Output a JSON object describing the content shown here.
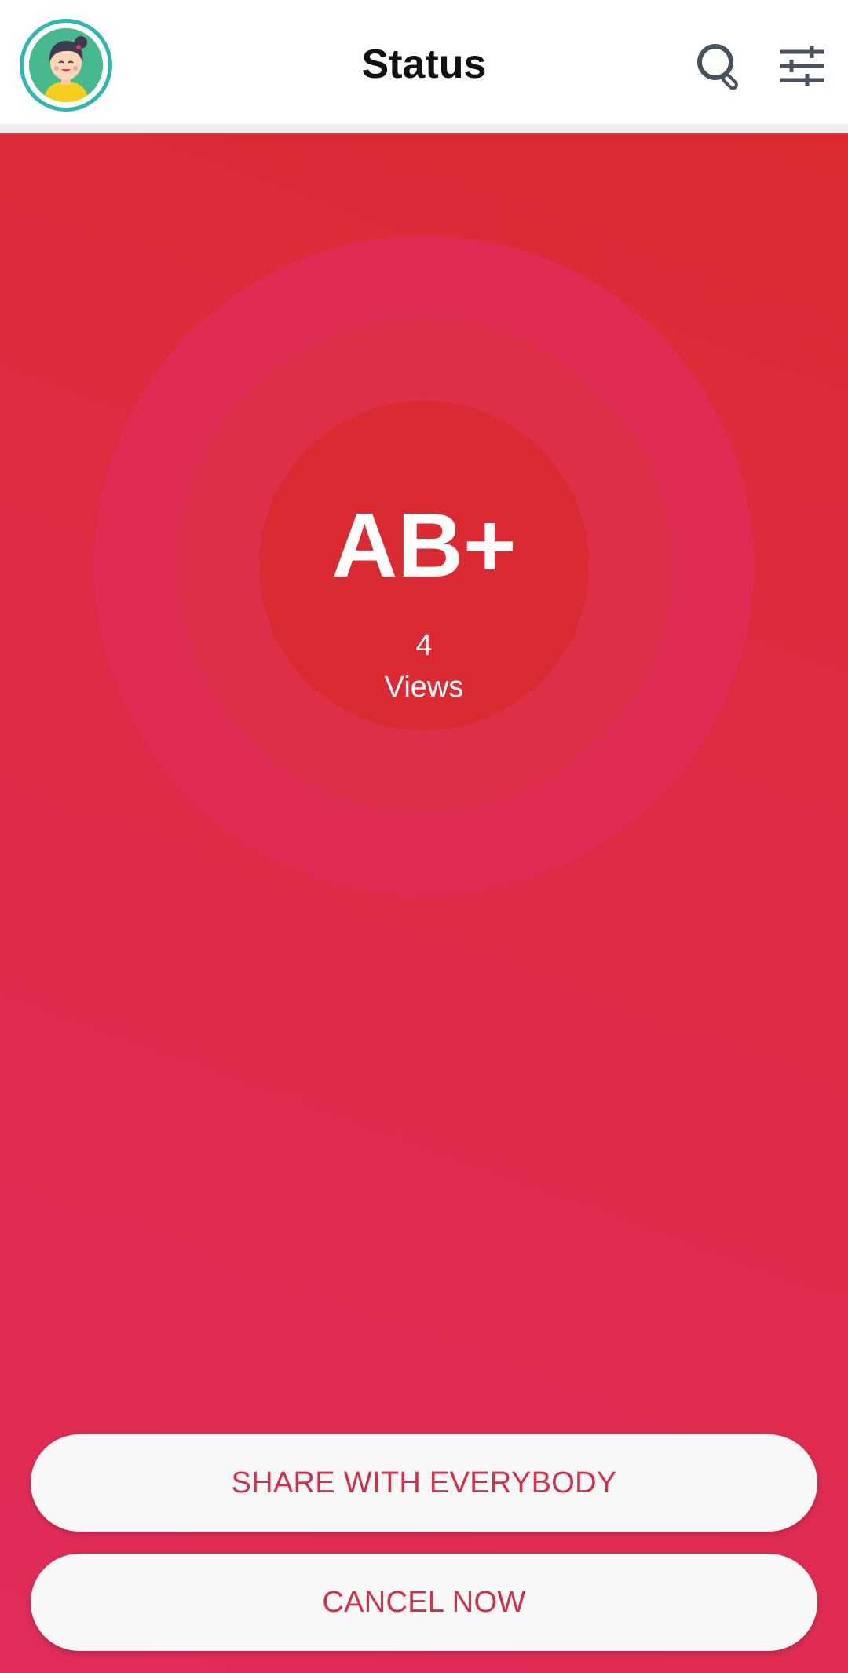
{
  "header": {
    "title": "Status",
    "avatar_icon": "user-avatar-icon",
    "search_icon": "search-icon",
    "filter_icon": "filter-sliders-icon"
  },
  "status": {
    "blood_type": "AB+",
    "views_count": "4",
    "views_label": "Views"
  },
  "actions": {
    "share_label": "SHARE WITH EVERYBODY",
    "cancel_label": "CANCEL NOW"
  },
  "colors": {
    "accent": "#dc2a33",
    "button_text": "#d0304a",
    "avatar_ring": "#2fb8b0"
  }
}
